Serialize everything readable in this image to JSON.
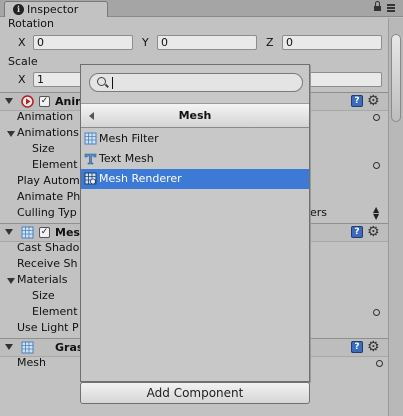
{
  "tab": {
    "label": "Inspector",
    "icon": "info-icon"
  },
  "rotation": {
    "label": "Rotation",
    "x_label": "X",
    "x": "0",
    "y_label": "Y",
    "y": "0",
    "z_label": "Z",
    "z": "0"
  },
  "scale": {
    "label": "Scale",
    "x_label": "X",
    "x": "1"
  },
  "animator": {
    "title": "Anim",
    "rows": [
      "Animation",
      "Animations",
      "Size",
      "Element",
      "Play Autom",
      "Animate Ph",
      "Culling Typ"
    ],
    "culling_value_fragment": "ers"
  },
  "mesh_renderer_comp": {
    "title": "Mes",
    "rows": [
      "Cast Shado",
      "Receive Sh",
      "Materials",
      "Size",
      "Element",
      "Use Light P"
    ]
  },
  "grass_comp": {
    "title": "Gras",
    "rows": [
      "Mesh"
    ]
  },
  "popup": {
    "search_placeholder": "",
    "title": "Mesh",
    "items": [
      {
        "label": "Mesh Filter",
        "icon": "mesh-filter-icon",
        "selected": false
      },
      {
        "label": "Text Mesh",
        "icon": "text-mesh-icon",
        "selected": false
      },
      {
        "label": "Mesh Renderer",
        "icon": "mesh-renderer-icon",
        "selected": true
      }
    ]
  },
  "add_component_label": "Add Component",
  "colors": {
    "selection": "#3d7ad6",
    "panel": "#c2c2c2",
    "help_icon": "#3b6cc0"
  }
}
